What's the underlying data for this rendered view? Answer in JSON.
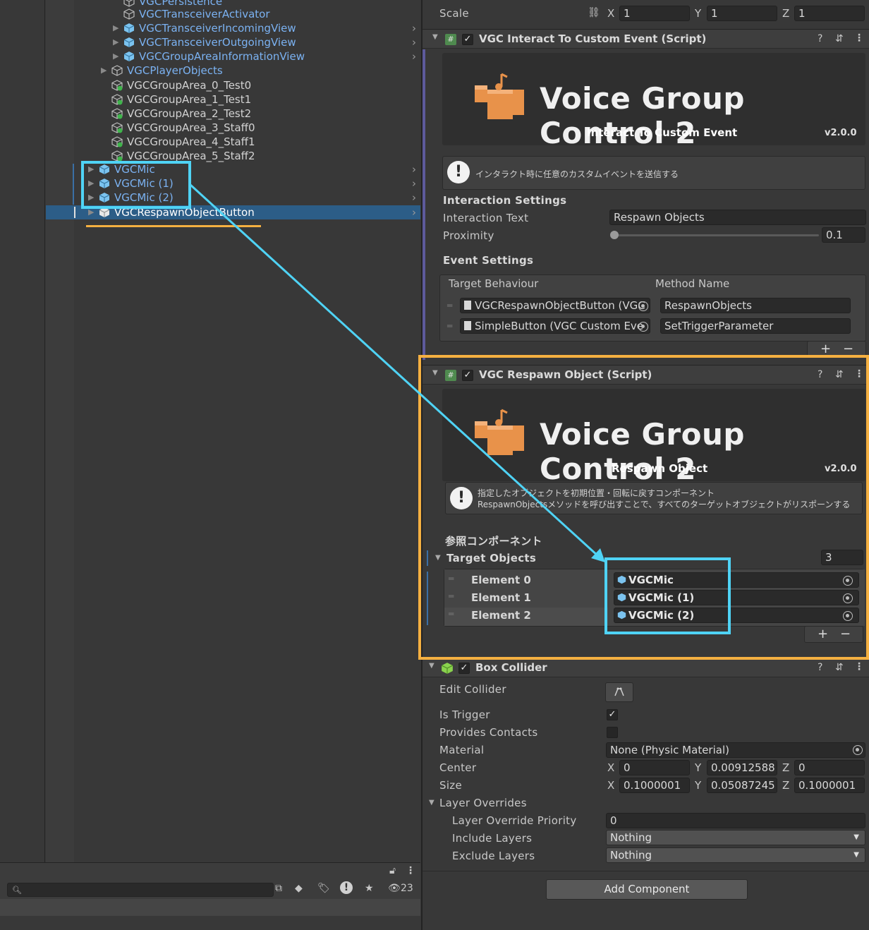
{
  "hierarchy": {
    "items": [
      {
        "label": "VGCPersistence",
        "color": "blue"
      },
      {
        "label": "VGCTransceiverActivator",
        "color": "blue"
      },
      {
        "label": "VGCTransceiverIncomingView",
        "color": "blue"
      },
      {
        "label": "VGCTransceiverOutgoingView",
        "color": "blue"
      },
      {
        "label": "VGCGroupAreaInformationView",
        "color": "blue"
      },
      {
        "label": "VGCPlayerObjects",
        "color": "blue"
      },
      {
        "label": "VGCGroupArea_0_Test0",
        "color": "grey"
      },
      {
        "label": "VGCGroupArea_1_Test1",
        "color": "grey"
      },
      {
        "label": "VGCGroupArea_2_Test2",
        "color": "grey"
      },
      {
        "label": "VGCGroupArea_3_Staff0",
        "color": "grey"
      },
      {
        "label": "VGCGroupArea_4_Staff1",
        "color": "grey"
      },
      {
        "label": "VGCGroupArea_5_Staff2",
        "color": "grey"
      },
      {
        "label": "VGCMic",
        "color": "blue"
      },
      {
        "label": "VGCMic (1)",
        "color": "blue"
      },
      {
        "label": "VGCMic (2)",
        "color": "blue"
      },
      {
        "label": "VGCRespawnObjectButton",
        "color": "white"
      }
    ],
    "hidden_count": "23"
  },
  "inspector": {
    "scale": {
      "label": "Scale",
      "x": "1",
      "y": "1",
      "z": "1"
    },
    "axis": {
      "x": "X",
      "y": "Y",
      "z": "Z"
    },
    "interact": {
      "header": "VGC Interact To Custom Event (Script)",
      "banner_title": "Voice Group Control 2",
      "banner_sub": "Interact To Custom Event",
      "version": "v2.0.0",
      "help": "インタラクト時に任意のカスタムイベントを送信する",
      "interaction_settings": "Interaction Settings",
      "interaction_text_label": "Interaction Text",
      "interaction_text": "Respawn Objects",
      "proximity_label": "Proximity",
      "proximity": "0.1",
      "event_settings": "Event Settings",
      "col_target": "Target Behaviour",
      "col_method": "Method Name",
      "events": [
        {
          "target": "VGCRespawnObjectButton (VGC",
          "method": "RespawnObjects"
        },
        {
          "target": "SimpleButton (VGC Custom Eve",
          "method": "SetTriggerParameter"
        }
      ]
    },
    "respawn": {
      "header": "VGC Respawn Object (Script)",
      "banner_title": "Voice Group Control 2",
      "banner_sub": "Respawn Object",
      "version": "v2.0.0",
      "help_line1": "指定したオブジェクトを初期位置・回転に戻すコンポーネント",
      "help_line2": "RespawnObjectsメソッドを呼び出すことで、すべてのターゲットオブジェクトがリスポーンする",
      "ref_label": "参照コンポーネント",
      "target_objects": "Target Objects",
      "count": "3",
      "elements": [
        {
          "label": "Element 0",
          "value": "VGCMic"
        },
        {
          "label": "Element 1",
          "value": "VGCMic (1)"
        },
        {
          "label": "Element 2",
          "value": "VGCMic (2)"
        }
      ]
    },
    "box": {
      "header": "Box Collider",
      "edit_collider": "Edit Collider",
      "is_trigger": "Is Trigger",
      "provides_contacts": "Provides Contacts",
      "material_label": "Material",
      "material": "None (Physic Material)",
      "center_label": "Center",
      "center": {
        "x": "0",
        "y": "0.00912588",
        "z": "0"
      },
      "size_label": "Size",
      "size": {
        "x": "0.1000001",
        "y": "0.05087245",
        "z": "0.1000001"
      },
      "layer_overrides": "Layer Overrides",
      "priority_label": "Layer Override Priority",
      "priority": "0",
      "include_label": "Include Layers",
      "include": "Nothing",
      "exclude_label": "Exclude Layers",
      "exclude": "Nothing"
    },
    "add_component": "Add Component"
  },
  "colors": {
    "highlight_cyan": "#4fd3f5",
    "highlight_orange": "#f5b041",
    "selection": "#2c5d87"
  }
}
